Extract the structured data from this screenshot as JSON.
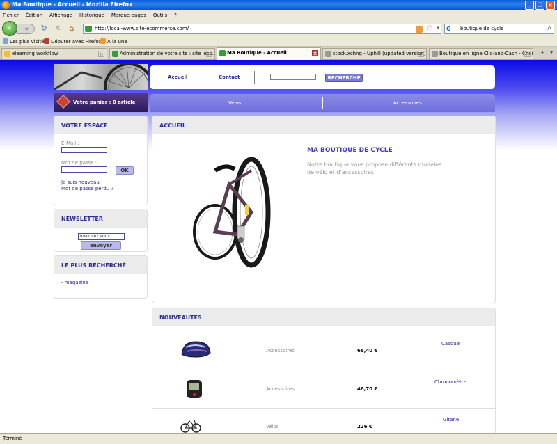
{
  "window": {
    "title": "Ma Boutique - Accueil - Mozilla Firefox"
  },
  "menu": [
    "Fichier",
    "Édition",
    "Affichage",
    "Historique",
    "Marque-pages",
    "Outils",
    "?"
  ],
  "nav": {
    "url": "http://local-www.site-ecommerce.com/",
    "search_value": "boutique de cycle",
    "search_engine_icon": "google-icon"
  },
  "bookmarks": [
    {
      "label": "Les plus visités"
    },
    {
      "label": "Débuter avec Firefox"
    },
    {
      "label": "À la une"
    }
  ],
  "tabs": [
    {
      "label": "elearning workflow",
      "active": false
    },
    {
      "label": "Administration de votre site : site_eco...",
      "active": false
    },
    {
      "label": "Ma Boutique - Accueil",
      "active": true
    },
    {
      "label": "stock.xchng - Uphill (updated version)...",
      "active": false
    },
    {
      "label": "Boutique en ligne Clic-and-Cash - Choi...",
      "active": false
    }
  ],
  "site": {
    "topmenu": {
      "home": "Accueil",
      "contact": "Contact",
      "search_button": "RECHERCHE"
    },
    "cart": "Votre panier : 0 article",
    "categories": [
      "Vélos",
      "Accessoires"
    ],
    "account": {
      "title": "VOTRE ESPACE",
      "email_label": "E-Mail :",
      "password_label": "Mot de passe :",
      "ok": "OK",
      "register": "Je suis nouveau",
      "forgot": "Mot de passe perdu ?"
    },
    "newsletter": {
      "title": "NEWSLETTER",
      "placeholder": "Inscrivez vous",
      "button": "envoyer"
    },
    "popular": {
      "title": "LE PLUS RECHERCHÉ",
      "items": [
        "- magazine"
      ]
    },
    "home": {
      "title": "ACCUEIL",
      "heading": "MA BOUTIQUE DE CYCLE",
      "description": "Notre boutique vous propose différents modèles de vélo et d'accessoires."
    },
    "news": {
      "title": "NOUVEAUTÉS",
      "products": [
        {
          "category": "Accessoires",
          "price": "68,40 €",
          "name": "Casque",
          "icon": "helmet-icon"
        },
        {
          "category": "Accessoires",
          "price": "48,70 €",
          "name": "Chronomètre",
          "icon": "bike-computer-icon"
        },
        {
          "category": "Vélos",
          "price": "226 €",
          "name": "Gitane",
          "icon": "bicycle-icon"
        }
      ]
    }
  },
  "status": "Terminé",
  "colors": {
    "accent": "#2b2b9e",
    "header_gradient_top": "#0a0ae8",
    "menu_purple": "#7b7bdc"
  }
}
